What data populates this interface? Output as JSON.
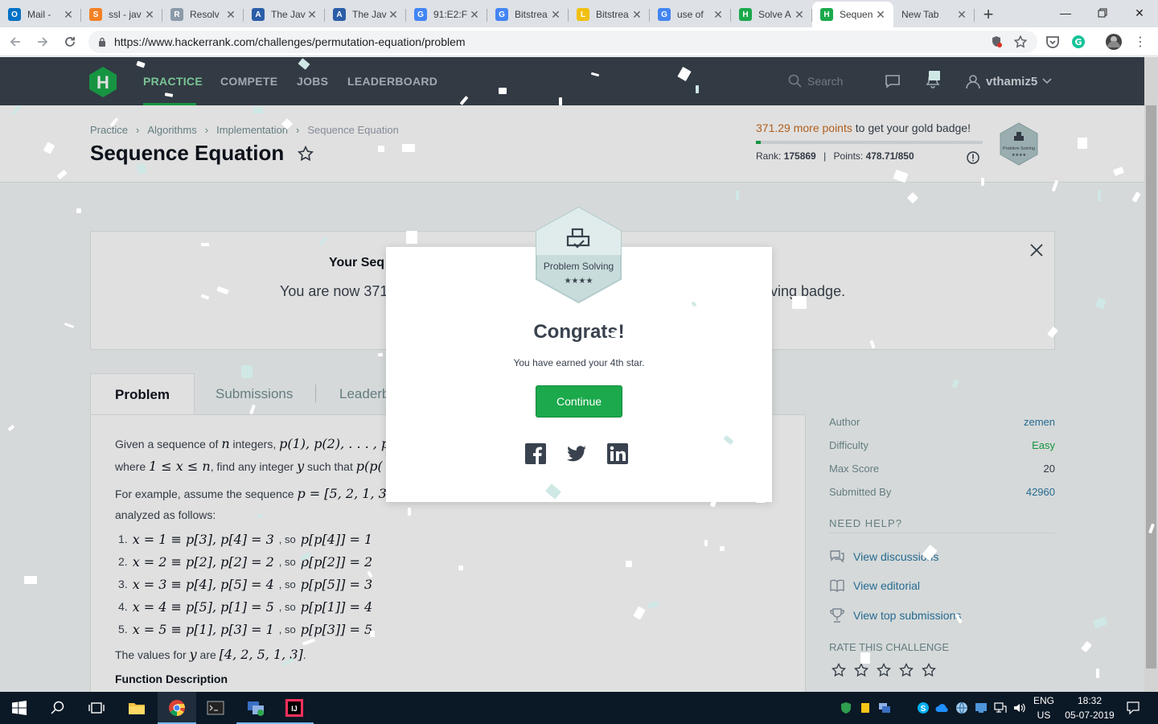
{
  "browser": {
    "tabs": [
      {
        "title": "Mail - ",
        "icon": "outlook-icon",
        "color": "#0072c6",
        "glyph": "O"
      },
      {
        "title": "ssl - jav",
        "icon": "stackoverflow-icon",
        "color": "#f48024",
        "glyph": "S"
      },
      {
        "title": "Resolv",
        "icon": "globe-icon",
        "color": "#8a9aa8",
        "glyph": "R"
      },
      {
        "title": "The Jav",
        "icon": "a-icon",
        "color": "#2b5ea8",
        "glyph": "A"
      },
      {
        "title": "The Jav",
        "icon": "a-icon",
        "color": "#2b5ea8",
        "glyph": "A"
      },
      {
        "title": "91:E2:F",
        "icon": "google-icon",
        "color": "#4285f4",
        "glyph": "G"
      },
      {
        "title": "Bitstrea",
        "icon": "google-icon",
        "color": "#4285f4",
        "glyph": "G"
      },
      {
        "title": "Bitstrea",
        "icon": "bolt-icon",
        "color": "#f0c010",
        "glyph": "L"
      },
      {
        "title": "use of",
        "icon": "google-icon",
        "color": "#4285f4",
        "glyph": "G"
      },
      {
        "title": "Solve A",
        "icon": "hackerrank-icon",
        "color": "#1ba94c",
        "glyph": "H"
      },
      {
        "title": "Sequen",
        "icon": "hackerrank-icon",
        "color": "#1ba94c",
        "glyph": "H"
      },
      {
        "title": "New Tab",
        "icon": "",
        "color": "",
        "glyph": ""
      }
    ],
    "url": "https://www.hackerrank.com/challenges/permutation-equation/problem"
  },
  "nav": {
    "items": [
      "PRACTICE",
      "COMPETE",
      "JOBS",
      "LEADERBOARD"
    ],
    "search_placeholder": "Search",
    "username": "vthamiz5"
  },
  "header": {
    "breadcrumb": [
      "Practice",
      "Algorithms",
      "Implementation",
      "Sequence Equation"
    ],
    "title": "Sequence Equation",
    "points_needed": "371.29 more points",
    "points_suffix": " to get your gold badge!",
    "progress_fraction": 0.02,
    "rank_label": "Rank: ",
    "rank_value": "175869",
    "points_label": "Points: ",
    "points_value": "478.71/850"
  },
  "notice": {
    "title_start": "Your Seq",
    "text_start": "You are now 371",
    "text_end": "ving badge."
  },
  "problem_tabs": [
    "Problem",
    "Submissions",
    "Leaderb"
  ],
  "problem": {
    "line1_text": "Given a sequence of ",
    "line1_n": "n",
    "line1_mid": " integers, ",
    "line1_math": "p(1), p(2), . . . , p(",
    "line2_where": "where ",
    "line2_math": "1 ≤ x ≤ n",
    "line2_text": ", find any integer ",
    "line2_y": "y",
    "line2_text2": " such that ",
    "line2_math2": "p(p(",
    "line3_text": "For example, assume the sequence ",
    "line3_math": "p = [5, 2, 1, 3,",
    "line4_text": "analyzed as follows:",
    "examples": [
      {
        "num": "1.",
        "a": "x = 1 ≡ p[3], p[4] = 3",
        "so": ", so ",
        "b": "p[p[4]] = 1"
      },
      {
        "num": "2.",
        "a": "x = 2 ≡ p[2], p[2] = 2",
        "so": ", so ",
        "b": "p[p[2]] = 2"
      },
      {
        "num": "3.",
        "a": "x = 3 ≡ p[4], p[5] = 4",
        "so": ", so ",
        "b": "p[p[5]] = 3"
      },
      {
        "num": "4.",
        "a": "x = 4 ≡ p[5], p[1] = 5",
        "so": ", so ",
        "b": "p[p[1]] = 4"
      },
      {
        "num": "5.",
        "a": "x = 5 ≡ p[1], p[3] = 1",
        "so": ", so ",
        "b": "p[p[3]] = 5"
      }
    ],
    "values_text": "The values for ",
    "values_y": "y",
    "values_mid": " are ",
    "values_math": "[4, 2, 5, 1, 3]",
    "values_end": ".",
    "function_heading": "Function Description"
  },
  "sidebar": {
    "author_label": "Author",
    "author": "zemen",
    "difficulty_label": "Difficulty",
    "difficulty": "Easy",
    "max_score_label": "Max Score",
    "max_score": "20",
    "submitted_label": "Submitted By",
    "submitted": "42960",
    "need_help": "NEED HELP?",
    "links": [
      "View discussions",
      "View editorial",
      "View top submissions"
    ],
    "rate_heading": "RATE THIS CHALLENGE"
  },
  "modal": {
    "badge_name": "Problem Solving",
    "badge_stars": "★★★★",
    "small_badge_name": "Problem Solving",
    "congrats": "Congrats!",
    "earned": "You have earned your 4th star.",
    "continue_label": "Continue"
  },
  "taskbar": {
    "lang_top": "ENG",
    "lang_bottom": "US",
    "time": "18:32",
    "date": "05-07-2019"
  },
  "colors": {
    "hr_dark": "#39424e",
    "hr_green": "#1ba94c",
    "link_blue": "#2b7aa6",
    "points_orange": "#c96d22"
  }
}
